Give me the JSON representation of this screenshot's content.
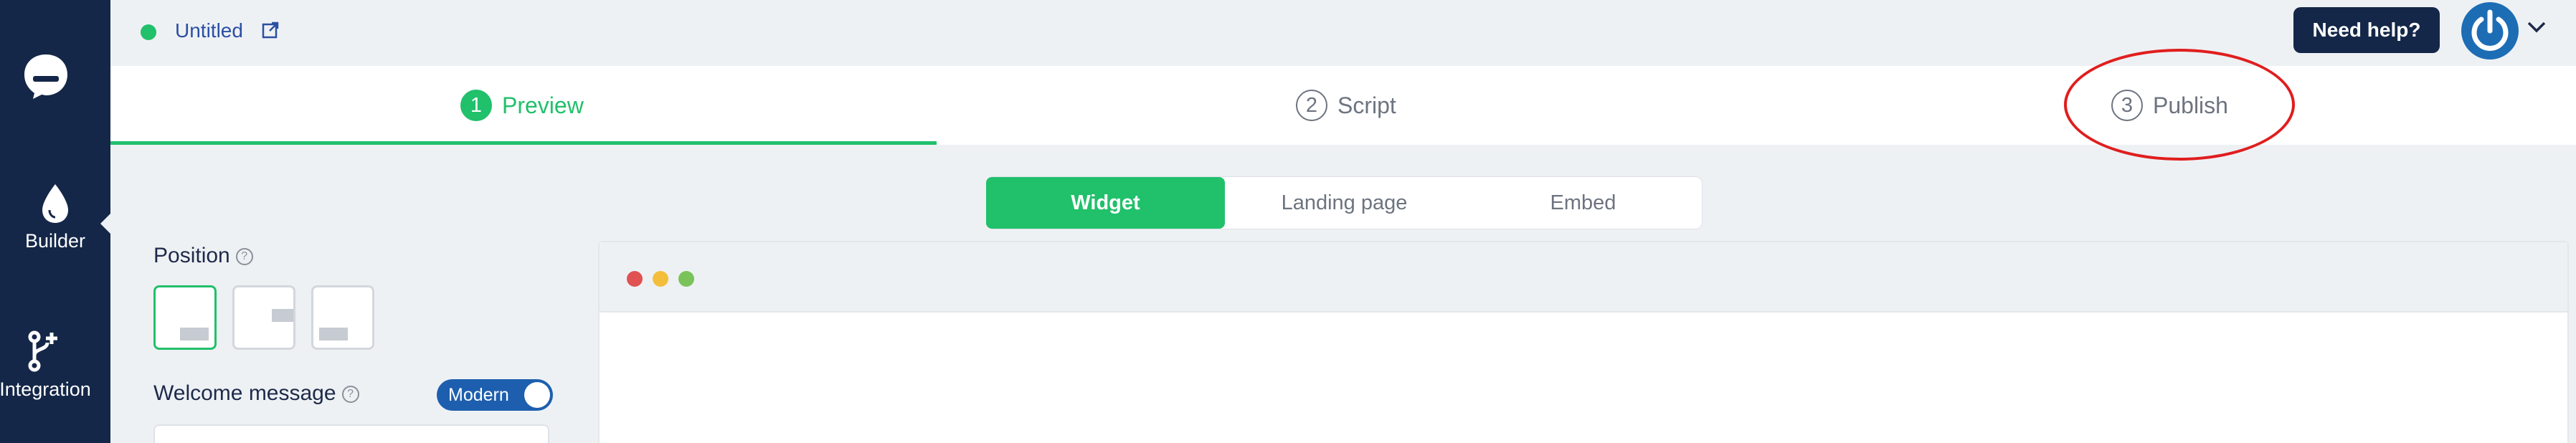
{
  "sidebar": {
    "items": [
      {
        "label": "Builder",
        "icon": "drop-icon"
      },
      {
        "label": "Integration",
        "icon": "branch-plus-icon"
      }
    ]
  },
  "topbar": {
    "doc_title": "Untitled",
    "status_color": "#21c06b",
    "help_label": "Need help?"
  },
  "steps": [
    {
      "num": "1",
      "label": "Preview"
    },
    {
      "num": "2",
      "label": "Script"
    },
    {
      "num": "3",
      "label": "Publish"
    }
  ],
  "modes": [
    "Widget",
    "Landing page",
    "Embed"
  ],
  "settings": {
    "position_label": "Position",
    "welcome_label": "Welcome message",
    "toggle_label": "Modern"
  },
  "colors": {
    "accent": "#21c06b",
    "navy": "#142748",
    "highlight": "#e01e1e"
  }
}
